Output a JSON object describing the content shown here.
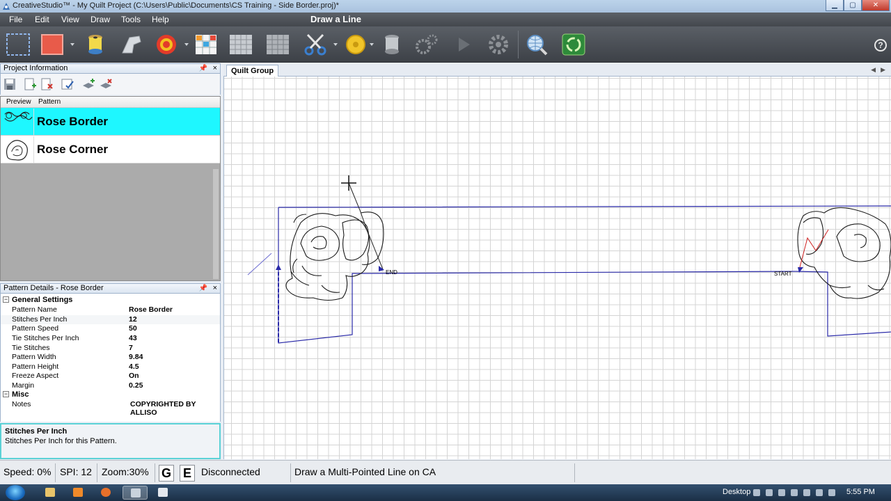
{
  "window": {
    "title": "CreativeStudio™ - My Quilt Project (C:\\Users\\Public\\Documents\\CS Training - Side Border.proj)*",
    "controls": [
      "minimize",
      "maximize",
      "close"
    ]
  },
  "menu": {
    "items": [
      "File",
      "Edit",
      "View",
      "Draw",
      "Tools",
      "Help"
    ],
    "mode_title": "Draw a Line"
  },
  "toolbar": {
    "tools": [
      {
        "icon": "selection-rect-icon"
      },
      {
        "icon": "red-square-icon",
        "dropdown": true
      },
      {
        "icon": "thread-spool-icon"
      },
      {
        "icon": "sewing-foot-icon"
      },
      {
        "icon": "target-icon",
        "dropdown": true
      },
      {
        "icon": "color-grid-icon"
      },
      {
        "icon": "grid-icon"
      },
      {
        "icon": "grid-plain-icon"
      },
      {
        "icon": "scissors-icon",
        "dropdown": true
      },
      {
        "icon": "tape-measure-icon",
        "dropdown": true
      },
      {
        "icon": "spool-gray-icon"
      },
      {
        "icon": "gears-icon"
      },
      {
        "icon": "play-arrow-icon"
      },
      {
        "icon": "gear-icon"
      },
      {
        "icon": "globe-search-icon"
      },
      {
        "icon": "recycle-icon"
      }
    ],
    "help_label": "?"
  },
  "project_panel": {
    "title": "Project Information",
    "pin": "📌",
    "close": "×",
    "columns": [
      "Preview",
      "Pattern"
    ],
    "patterns": [
      {
        "name": "Rose Border",
        "selected": true
      },
      {
        "name": "Rose Corner",
        "selected": false
      }
    ]
  },
  "details_panel": {
    "title": "Pattern Details - Rose Border",
    "categories": [
      {
        "name": "General Settings",
        "toggle": "⊟",
        "props": [
          {
            "key": "Pattern Name",
            "value": "Rose Border"
          },
          {
            "key": "Stitches Per Inch",
            "value": "12"
          },
          {
            "key": "Pattern Speed",
            "value": "50"
          },
          {
            "key": "Tie Stitches Per Inch",
            "value": "43"
          },
          {
            "key": "Tie Stitches",
            "value": "7"
          },
          {
            "key": "Pattern Width",
            "value": "9.84"
          },
          {
            "key": "Pattern Height",
            "value": "4.5"
          },
          {
            "key": "Freeze Aspect",
            "value": "On"
          },
          {
            "key": "Margin",
            "value": "0.25"
          }
        ]
      },
      {
        "name": "Misc",
        "toggle": "⊟",
        "props": [
          {
            "key": "Notes",
            "value": "COPYRIGHTED BY ALLISO"
          }
        ]
      }
    ],
    "description_title": "Stitches Per Inch",
    "description_text": "Stitches Per Inch for this Pattern."
  },
  "canvas": {
    "tab_label": "Quilt Group",
    "nav_prev": "◀",
    "nav_next": "▶",
    "end_label": "END",
    "start_label": "START"
  },
  "status": {
    "speed": "Speed: 0%",
    "spi": "SPI: 12",
    "zoom": "Zoom:30%",
    "key_g": "G",
    "key_e": "E",
    "connection": "Disconnected",
    "hint": "Draw a Multi-Pointed Line on CA"
  },
  "taskbar": {
    "desktop_label": "Desktop",
    "clock": "5:55 PM"
  },
  "colors": {
    "selection": "#1ef7ff",
    "pattern_outline": "#2a2aa8",
    "description_border": "#5bd1d6"
  }
}
